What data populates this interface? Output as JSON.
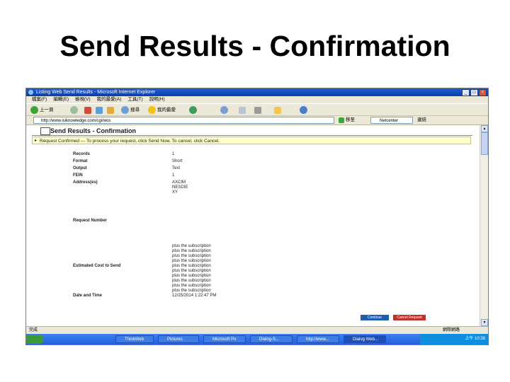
{
  "slide": {
    "title": "Send Results - Confirmation"
  },
  "window": {
    "title": "Listing Web Send Results - Microsoft Internet Explorer",
    "buttons": {
      "minimize": "_",
      "maximize": "□",
      "close": "×"
    }
  },
  "menu": {
    "items": [
      "檔案(F)",
      "編輯(E)",
      "檢視(V)",
      "我的最愛(A)",
      "工具(T)",
      "說明(H)"
    ]
  },
  "toolbar": {
    "back_label": "上一頁",
    "search_label": "搜尋",
    "favorites_label": "我的最愛",
    "go_label": "移至",
    "links_label": "連結"
  },
  "address": {
    "value": "http://www.isiknowledge.com/cgi/wos"
  },
  "search": {
    "placeholder": "Netcenter"
  },
  "page": {
    "heading": "Send Results - Confirmation",
    "banner": "Request Confirmed — To process your request, click Send Now. To cancel, click Cancel.",
    "fields": {
      "records_label": "Records",
      "records_value": "1",
      "format_label": "Format",
      "format_value": "Short",
      "output_label": "Output",
      "output_value": "Text",
      "fein_label": "FEIN",
      "fein_value": "1",
      "address_label": "Address(es)",
      "address_values": [
        "AXCIM",
        "NESDIE",
        "XY"
      ],
      "request_label": "Request Number",
      "cost_label": "Estimated Cost to Send",
      "cost_values": [
        "plus the subscription",
        "plus the subscription",
        "plus the subscription",
        "plus the subscription",
        "plus the subscription",
        "plus the subscription",
        "plus the subscription",
        "plus the subscription",
        "plus the subscription",
        "plus the subscription"
      ],
      "date_label": "Date and Time",
      "date_value": "12/25/2014 1:22:47 PM"
    },
    "buttons": {
      "continue": "Continue",
      "cancel": "Cancel Request"
    }
  },
  "status": {
    "left": "完成",
    "right": "網際網路"
  },
  "taskbar": {
    "tasks": [
      "ThinkWeb",
      "Pictures",
      "Microsoft Po",
      "Dialog-S...",
      "http://www...",
      "Dialog Web..."
    ],
    "clock": "上午 10:38"
  },
  "colors": {
    "titlebar": "#0a3fa8",
    "banner_bg": "#ffffcc",
    "continue": "#1e5fb0",
    "cancel": "#c0302a",
    "taskbar": "#245edb"
  }
}
